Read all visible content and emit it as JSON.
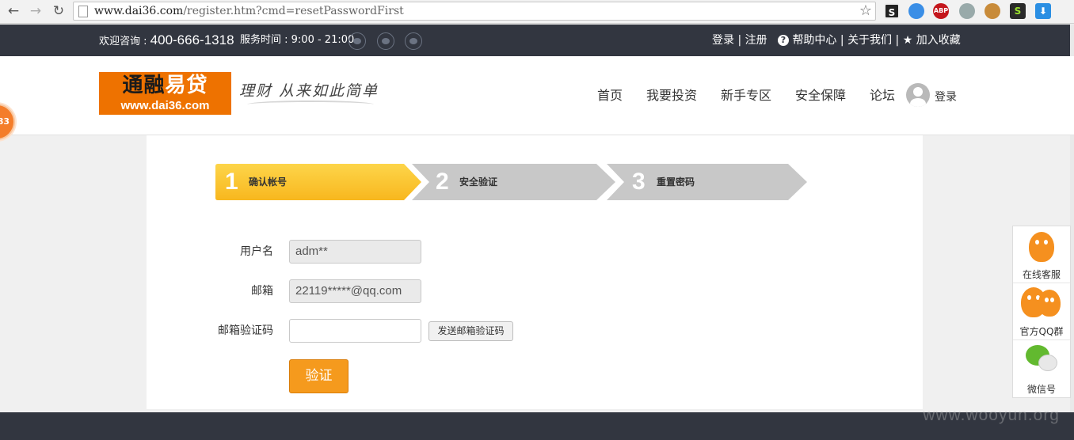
{
  "browser": {
    "url_host": "www.dai36.com",
    "url_path": "/register.htm?cmd=resetPasswordFirst",
    "back_icon": "back-arrow-icon",
    "forward_icon": "forward-arrow-icon",
    "reload_icon": "reload-icon",
    "extensions": {
      "abp_label": "ABP",
      "s_label": "S"
    }
  },
  "topbar": {
    "consult_label": "欢迎咨询 :",
    "phone": "400-666-1318",
    "hours": "服务时间 : 9:00 - 21:00",
    "login": "登录",
    "sep": "|",
    "register": "注册",
    "help_glyph": "?",
    "help": "帮助中心",
    "about": "关于我们",
    "favorite": "加入收藏"
  },
  "header": {
    "logo_line1_a": "通融",
    "logo_line1_b": "易贷",
    "logo_line2": "www.dai36.com",
    "slogan": "理财 从来如此简单",
    "nav": [
      "首页",
      "我要投资",
      "新手专区",
      "安全保障",
      "论坛"
    ],
    "login": "登录"
  },
  "left_badge": "83",
  "steps": [
    {
      "num": "1",
      "label": "确认帐号",
      "active": true
    },
    {
      "num": "2",
      "label": "安全验证",
      "active": false
    },
    {
      "num": "3",
      "label": "重置密码",
      "active": false
    }
  ],
  "form": {
    "username_label": "用户名",
    "username_value": "adm**",
    "email_label": "邮箱",
    "email_value": "22119*****@qq.com",
    "code_label": "邮箱验证码",
    "code_value": "",
    "send_code_button": "发送邮箱验证码",
    "verify_button": "验证"
  },
  "side_panel": {
    "online_service": "在线客服",
    "qq_group": "官方QQ群",
    "wechat": "微信号"
  },
  "watermark": "www.wooyun.org",
  "colors": {
    "topbar_bg": "#323640",
    "brand_orange": "#ee7200",
    "active_step": "#fbc52f",
    "inactive_step": "#c8c8c8",
    "verify_button": "#f59a1d"
  }
}
